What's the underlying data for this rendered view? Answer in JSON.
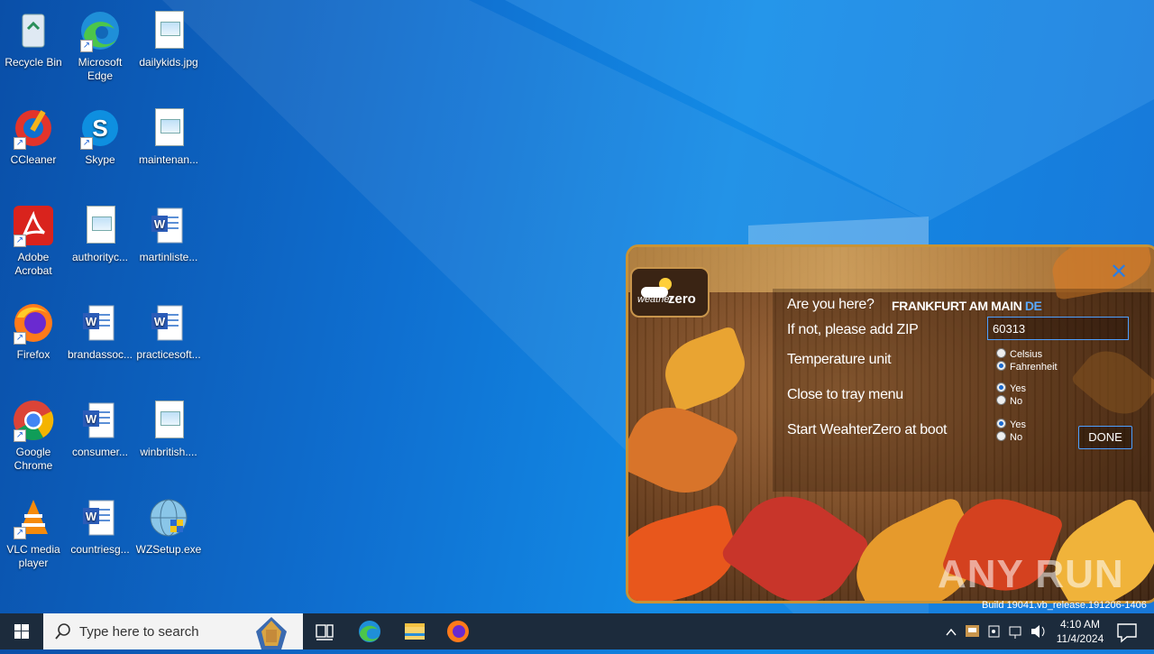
{
  "desktop": {
    "icons": [
      {
        "label": "Recycle Bin"
      },
      {
        "label": "Microsoft Edge"
      },
      {
        "label": "dailykids.jpg"
      },
      {
        "label": "CCleaner"
      },
      {
        "label": "Skype"
      },
      {
        "label": "maintenan..."
      },
      {
        "label": "Adobe Acrobat"
      },
      {
        "label": "authorityc..."
      },
      {
        "label": "martinliste..."
      },
      {
        "label": "Firefox"
      },
      {
        "label": "brandassoc..."
      },
      {
        "label": "practicesoft..."
      },
      {
        "label": "Google Chrome"
      },
      {
        "label": "consumer..."
      },
      {
        "label": "winbritish...."
      },
      {
        "label": "VLC media player"
      },
      {
        "label": "countriesg..."
      },
      {
        "label": "WZSetup.exe"
      }
    ]
  },
  "widget": {
    "logo_weather": "weather",
    "logo_zero": "zero",
    "question": "Are you here?",
    "city": "FRANKFURT AM MAIN",
    "country": "DE",
    "zip_label": "If not, please add ZIP",
    "zip_value": "60313",
    "temp_label": "Temperature unit",
    "temp_options": [
      "Celsius",
      "Fahrenheit"
    ],
    "temp_selected": "Fahrenheit",
    "tray_label": "Close to tray menu",
    "tray_options": [
      "Yes",
      "No"
    ],
    "tray_selected": "Yes",
    "boot_label": "Start WeahterZero at boot",
    "boot_options": [
      "Yes",
      "No"
    ],
    "boot_selected": "Yes",
    "done_label": "DONE",
    "close_glyph": "✕"
  },
  "watermark": "ANY RUN",
  "build": "Build 19041.vb_release.191206-1406",
  "taskbar": {
    "search_placeholder": "Type here to search",
    "time": "4:10 AM",
    "date": "11/4/2024"
  },
  "colors": {
    "desktop_blue": "#0f6fd0",
    "taskbar": "#1c2b3c",
    "widget_accent": "#4ea0ff",
    "widget_frame": "#c89336"
  }
}
